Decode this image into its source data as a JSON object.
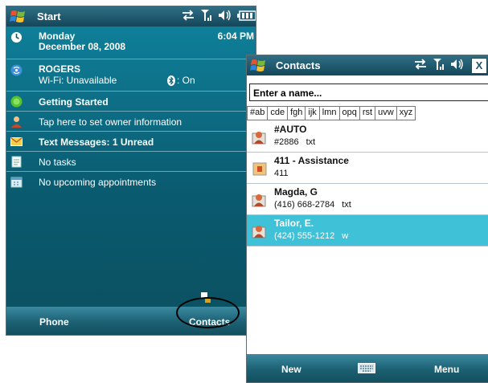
{
  "today": {
    "title": "Start",
    "time": "6:04 PM",
    "date_day": "Monday",
    "date_full": "December 08, 2008",
    "carrier": "ROGERS",
    "wifi_status": "Wi-Fi: Unavailable",
    "bluetooth_status": ": On",
    "getting_started": "Getting Started",
    "owner_info": "Tap here to set owner information",
    "messages": "Text Messages: 1 Unread",
    "tasks": "No tasks",
    "appointments": "No upcoming appointments",
    "softkey_left": "Phone",
    "softkey_right": "Contacts"
  },
  "contacts": {
    "title": "Contacts",
    "close_label": "X",
    "search_placeholder": "Enter a name...",
    "tabs": [
      "#ab",
      "cde",
      "fgh",
      "ijk",
      "lmn",
      "opq",
      "rst",
      "uvw",
      "xyz"
    ],
    "list": [
      {
        "name": "#AUTO",
        "number": "#2886",
        "type": "txt",
        "selected": false
      },
      {
        "name": "411 - Assistance",
        "number": "411",
        "type": "",
        "selected": false
      },
      {
        "name": "Magda, G",
        "number": "(416) 668-2784",
        "type": "txt",
        "selected": false
      },
      {
        "name": "Tailor, E.",
        "number": "(424) 555-1212",
        "type": "w",
        "selected": true
      }
    ],
    "softkey_left": "New",
    "softkey_right": "Menu"
  },
  "colors": {
    "today_background": "#0e6276",
    "selection": "#3fc1d8",
    "titlebar": "#1f5b70"
  },
  "icons": [
    "windows-start-logo",
    "sync-icon",
    "signal-icon",
    "speaker-icon",
    "battery-icon",
    "clock-icon",
    "wifi-icon",
    "bluetooth-icon",
    "getting-started-icon",
    "owner-icon",
    "envelope-icon",
    "tasks-icon",
    "calendar-icon",
    "keyboard-icon",
    "contact-card-icon"
  ]
}
